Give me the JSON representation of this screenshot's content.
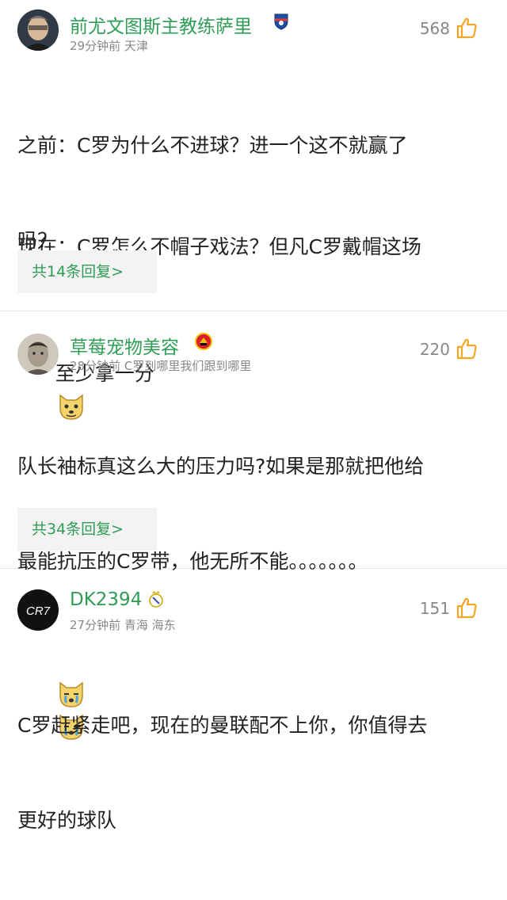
{
  "comments": [
    {
      "username": "前尤文图斯主教练萨里",
      "time": "29分钟前",
      "location": "天津",
      "likes": "568",
      "line1": "之前：C罗为什么不进球？进一个这不就赢了",
      "line2": "吗？",
      "line3": "现在：C罗怎么不帽子戏法？但凡C罗戴帽这场",
      "line4": "至少拿一分",
      "replies": "共14条回复>"
    },
    {
      "username": "草莓宠物美容",
      "time": "28分钟前",
      "location": "C罗到哪里我们跟到哪里",
      "likes": "220",
      "line1": "队长袖标真这么大的压力吗?如果是那就把他给",
      "line2": "最能抗压的C罗带，他无所不能。。。。。。。",
      "replies": "共34条回复>"
    },
    {
      "username": "DK2394",
      "time": "27分钟前",
      "location": "青海 海东",
      "likes": "151",
      "avatar_text": "CR7",
      "line1": "C罗赶紧走吧，现在的曼联配不上你，你值得去",
      "line2": "更好的球队"
    }
  ],
  "colors": {
    "username": "#2f9d57",
    "meta": "#888888",
    "accent_like": "#f5a623"
  },
  "icons": [
    "thumbs-up-icon",
    "team-badge-icon",
    "man-utd-badge-icon",
    "real-madrid-badge-icon",
    "dog-emoji-icon",
    "crying-dog-emoji-icon"
  ]
}
